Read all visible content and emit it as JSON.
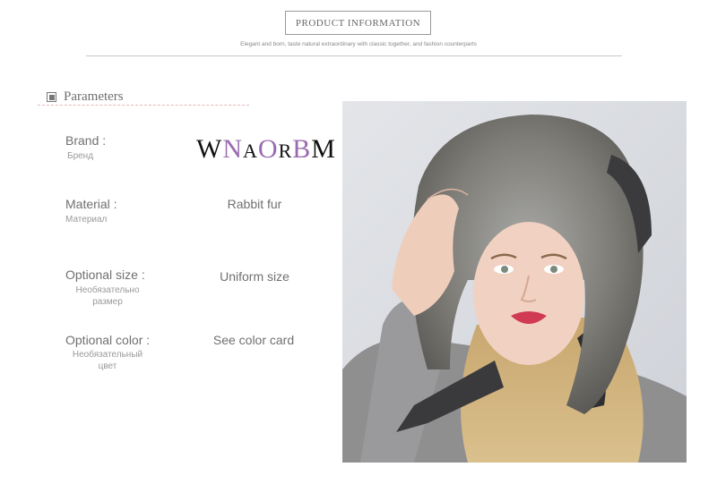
{
  "header": {
    "title": "PRODUCT INFORMATION",
    "subtitle": "Elegant and born, taste natural extraordinary with classic together, and fashion counterparts"
  },
  "parameters": {
    "heading": "Parameters",
    "rows": [
      {
        "label": "Brand :",
        "sub": "Бренд",
        "value": ""
      },
      {
        "label": "Material :",
        "sub": "Материал",
        "value": "Rabbit fur"
      },
      {
        "label": "Optional size :",
        "sub": "Необязательно размер",
        "value": "Uniform size"
      },
      {
        "label": "Optional color :",
        "sub": "Необязательный цвет",
        "value": "See color card"
      }
    ]
  },
  "brand_logo": {
    "text": "WNAORBM",
    "colors": {
      "dark": "#111111",
      "purple": "#9a6bb0"
    }
  },
  "photo": {
    "description_icon": "model-photo"
  }
}
